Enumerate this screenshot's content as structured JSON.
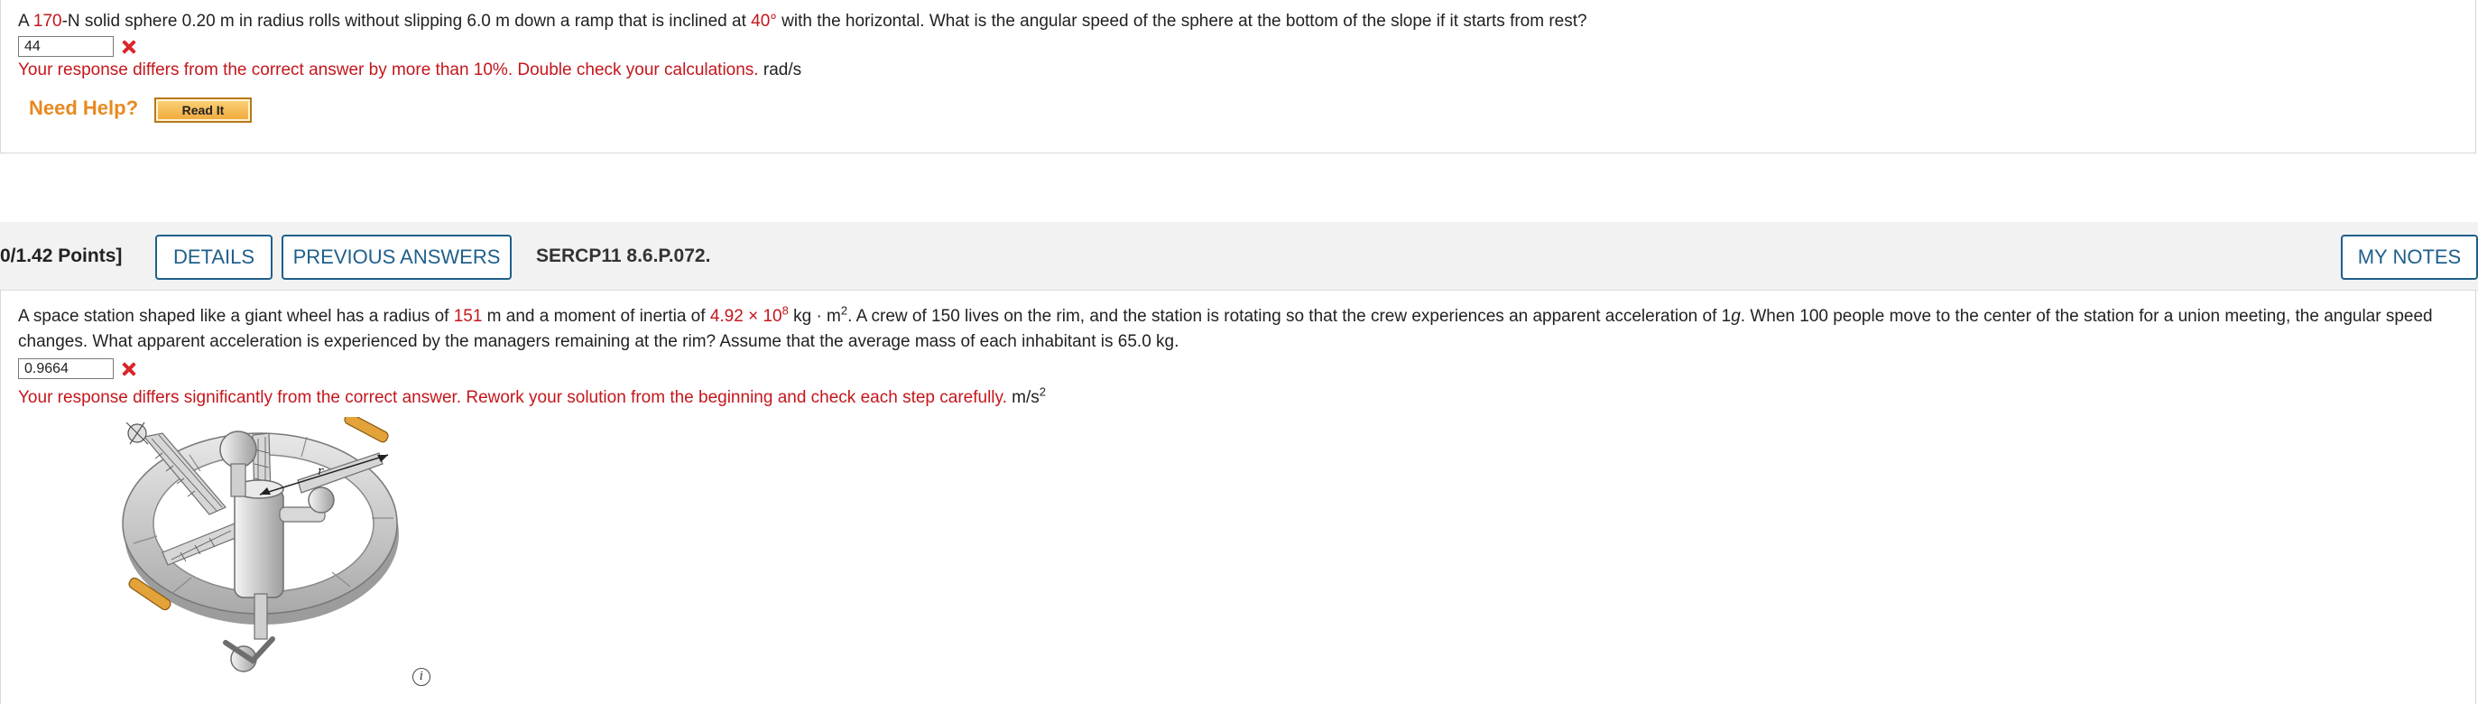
{
  "question1": {
    "text_parts": [
      "A ",
      "170",
      "-N solid sphere 0.20 m in radius rolls without slipping 6.0 m down a ramp that is inclined at ",
      "40°",
      " with the horizontal. What is the angular speed of the sphere at the bottom of the slope if it starts from rest?"
    ],
    "answer_value": "44",
    "feedback": "Your response differs from the correct answer by more than 10%. Double check your calculations.",
    "unit": "rad/s",
    "need_help_label": "Need Help?",
    "read_it_label": "Read It"
  },
  "question2_header": {
    "points": "0/1.42 Points]",
    "details_label": "DETAILS",
    "previous_answers_label": "PREVIOUS ANSWERS",
    "code": "SERCP11 8.6.P.072.",
    "my_notes_label": "MY NOTES"
  },
  "question2": {
    "text_a": "A space station shaped like a giant wheel has a radius of ",
    "radius_value": "151",
    "text_b": " m and a moment of inertia of ",
    "inertia_value": "4.92 × 10",
    "inertia_exp": "8",
    "text_c": " kg · m",
    "text_c_exp": "2",
    "text_d": ". A crew of 150 lives on the rim, and the station is rotating so that the crew experiences an apparent acceleration of 1",
    "g_symbol": "g",
    "text_e": ". When 100 people move to the center of the station for a union meeting, the angular speed changes. What apparent acceleration is experienced by the managers remaining at the rim? Assume that the average mass of each inhabitant is 65.0 kg.",
    "answer_value": "0.9664",
    "feedback": "Your response differs significantly from the correct answer. Rework your solution from the beginning and check each step carefully.",
    "unit": "m/s",
    "unit_exp": "2",
    "figure_label": "r",
    "info_icon_glyph": "i"
  },
  "colors": {
    "error_red": "#c4161c",
    "link_blue": "#1f5f8b",
    "help_orange": "#e8891f"
  }
}
